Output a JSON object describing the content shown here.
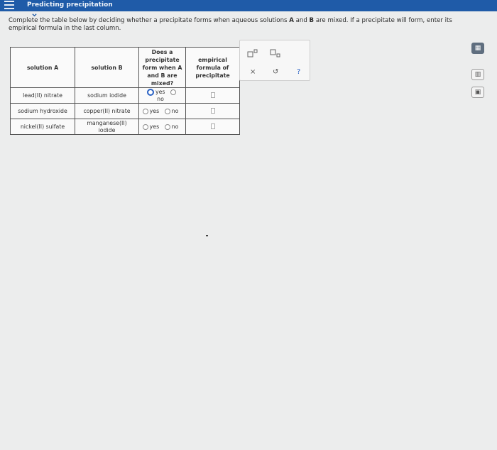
{
  "header": {
    "title": "Predicting precipitation",
    "bar_color": "#1f5ba8"
  },
  "prompt": {
    "part1": "Complete the table below by deciding whether a precipitate forms when aqueous solutions ",
    "a": "A",
    "and": " and ",
    "b": "B",
    "part2": " are mixed. If a precipitate will form, enter its empirical formula in the last column."
  },
  "table": {
    "headers": {
      "solution_a": "solution A",
      "solution_b": "solution B",
      "precip_q": "Does a precipitate form when A and B are mixed?",
      "formula": "empirical formula of precipitate"
    },
    "rows": [
      {
        "a": "lead(II) nitrate",
        "b": "sodium iodide",
        "yes": "yes",
        "no": "no",
        "selected": "yes"
      },
      {
        "a": "sodium hydroxide",
        "b": "copper(II) nitrate",
        "yes": "yes",
        "no": "no",
        "selected": ""
      },
      {
        "a": "nickel(II) sulfate",
        "b": "manganese(II) iodide",
        "yes": "yes",
        "no": "no",
        "selected": ""
      }
    ]
  },
  "tools": {
    "superscript_icon": "superscript-icon",
    "subscript_icon": "subscript-icon",
    "clear": "×",
    "undo": "↺",
    "help": "?"
  },
  "side_tools": [
    "calculator-icon",
    "periodic-table-icon",
    "reference-icon"
  ]
}
